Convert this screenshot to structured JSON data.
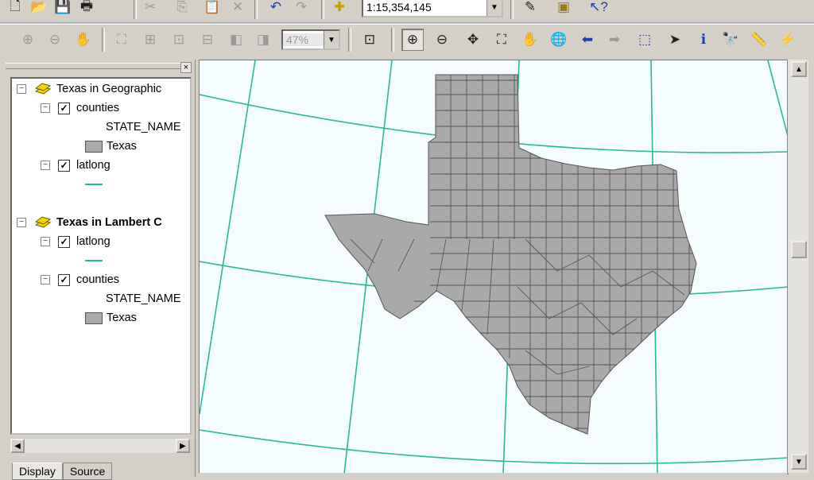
{
  "toolbar_standard": {
    "scale_value": "1:15,354,145",
    "buttons": [
      "new-icon",
      "open-icon",
      "save-icon",
      "print-icon",
      "cut-icon",
      "copy-icon",
      "paste-icon",
      "delete-icon",
      "undo-icon",
      "redo-icon",
      "add-data-icon",
      "editor-icon",
      "arccatalog-icon",
      "whats-this-icon"
    ]
  },
  "toolbar_tools": {
    "zoom_percent": "47%"
  },
  "toc": {
    "frames": [
      {
        "name": "Texas in Geographic",
        "active": false,
        "layers": [
          {
            "name": "counties",
            "checked": true,
            "field": "STATE_NAME",
            "class_label": "Texas",
            "symbol": "polygon"
          },
          {
            "name": "latlong",
            "checked": true,
            "symbol": "line"
          }
        ]
      },
      {
        "name": "Texas in Lambert C",
        "active": true,
        "layers": [
          {
            "name": "latlong",
            "checked": true,
            "symbol": "line"
          },
          {
            "name": "counties",
            "checked": true,
            "field": "STATE_NAME",
            "class_label": "Texas",
            "symbol": "polygon"
          }
        ]
      }
    ],
    "tabs": [
      "Display",
      "Source"
    ],
    "close_symbol": "×"
  },
  "map": {
    "background": "#f4fcfd",
    "graticule_color": "#2ab79a",
    "polygon_fill": "#a9a9a9",
    "polygon_stroke": "#555555"
  }
}
